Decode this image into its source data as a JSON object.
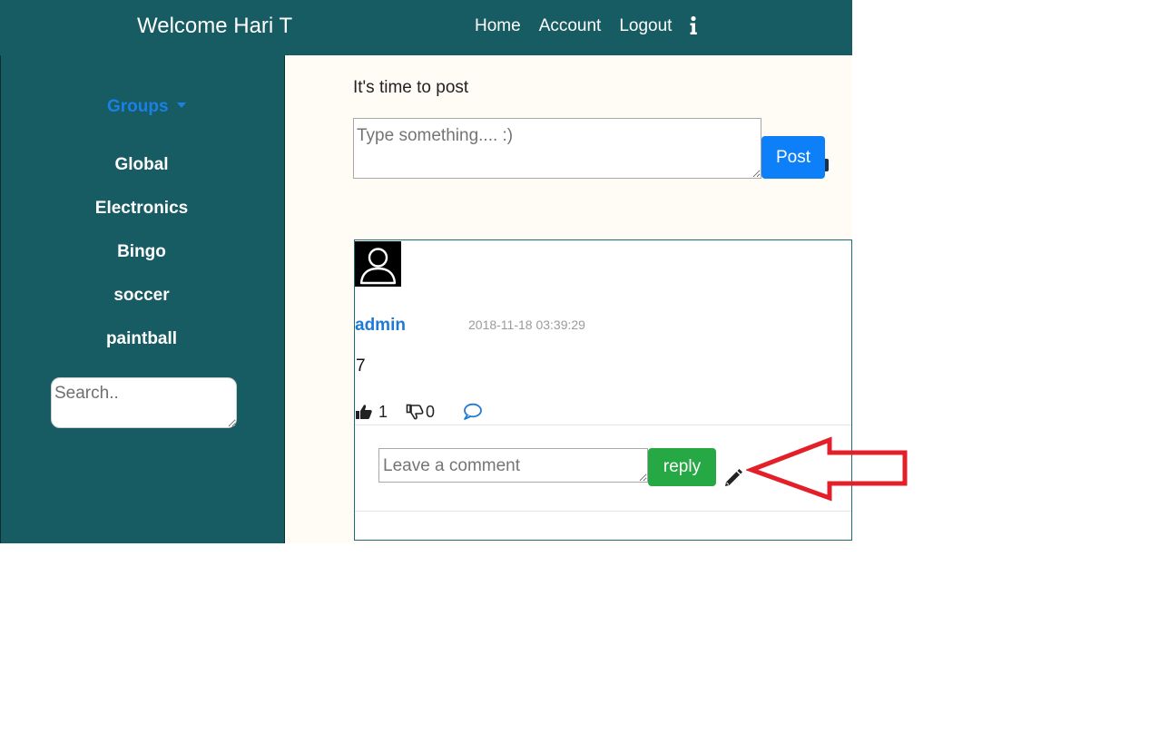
{
  "header": {
    "welcome": "Welcome Hari T",
    "nav": {
      "home": "Home",
      "account": "Account",
      "logout": "Logout",
      "info_icon": "info-icon"
    }
  },
  "sidebar": {
    "groups_label": "Groups",
    "groups": [
      "Global",
      "Electronics",
      "Bingo",
      "soccer",
      "paintball"
    ],
    "search_placeholder": "Search.."
  },
  "composer": {
    "prompt": "It's time to post",
    "placeholder": "Type something.... :)",
    "post_button": "Post"
  },
  "post": {
    "author": "admin",
    "timestamp": "2018-11-18 03:39:29",
    "body": "7",
    "likes": "1",
    "dislikes": "0",
    "comment_placeholder": "Leave a comment",
    "reply_button": "reply",
    "icons": [
      "user-avatar-icon",
      "thumbs-up-icon",
      "thumbs-down-icon",
      "comment-icon",
      "pencil-icon"
    ]
  },
  "annotation": {
    "arrow_color": "#e3202a"
  },
  "colors": {
    "header_bg": "#175b63",
    "groups_link": "#1a80e6",
    "post_button": "#0d7ff8",
    "reply_button": "#26a844",
    "main_bg": "#fffcf5"
  }
}
